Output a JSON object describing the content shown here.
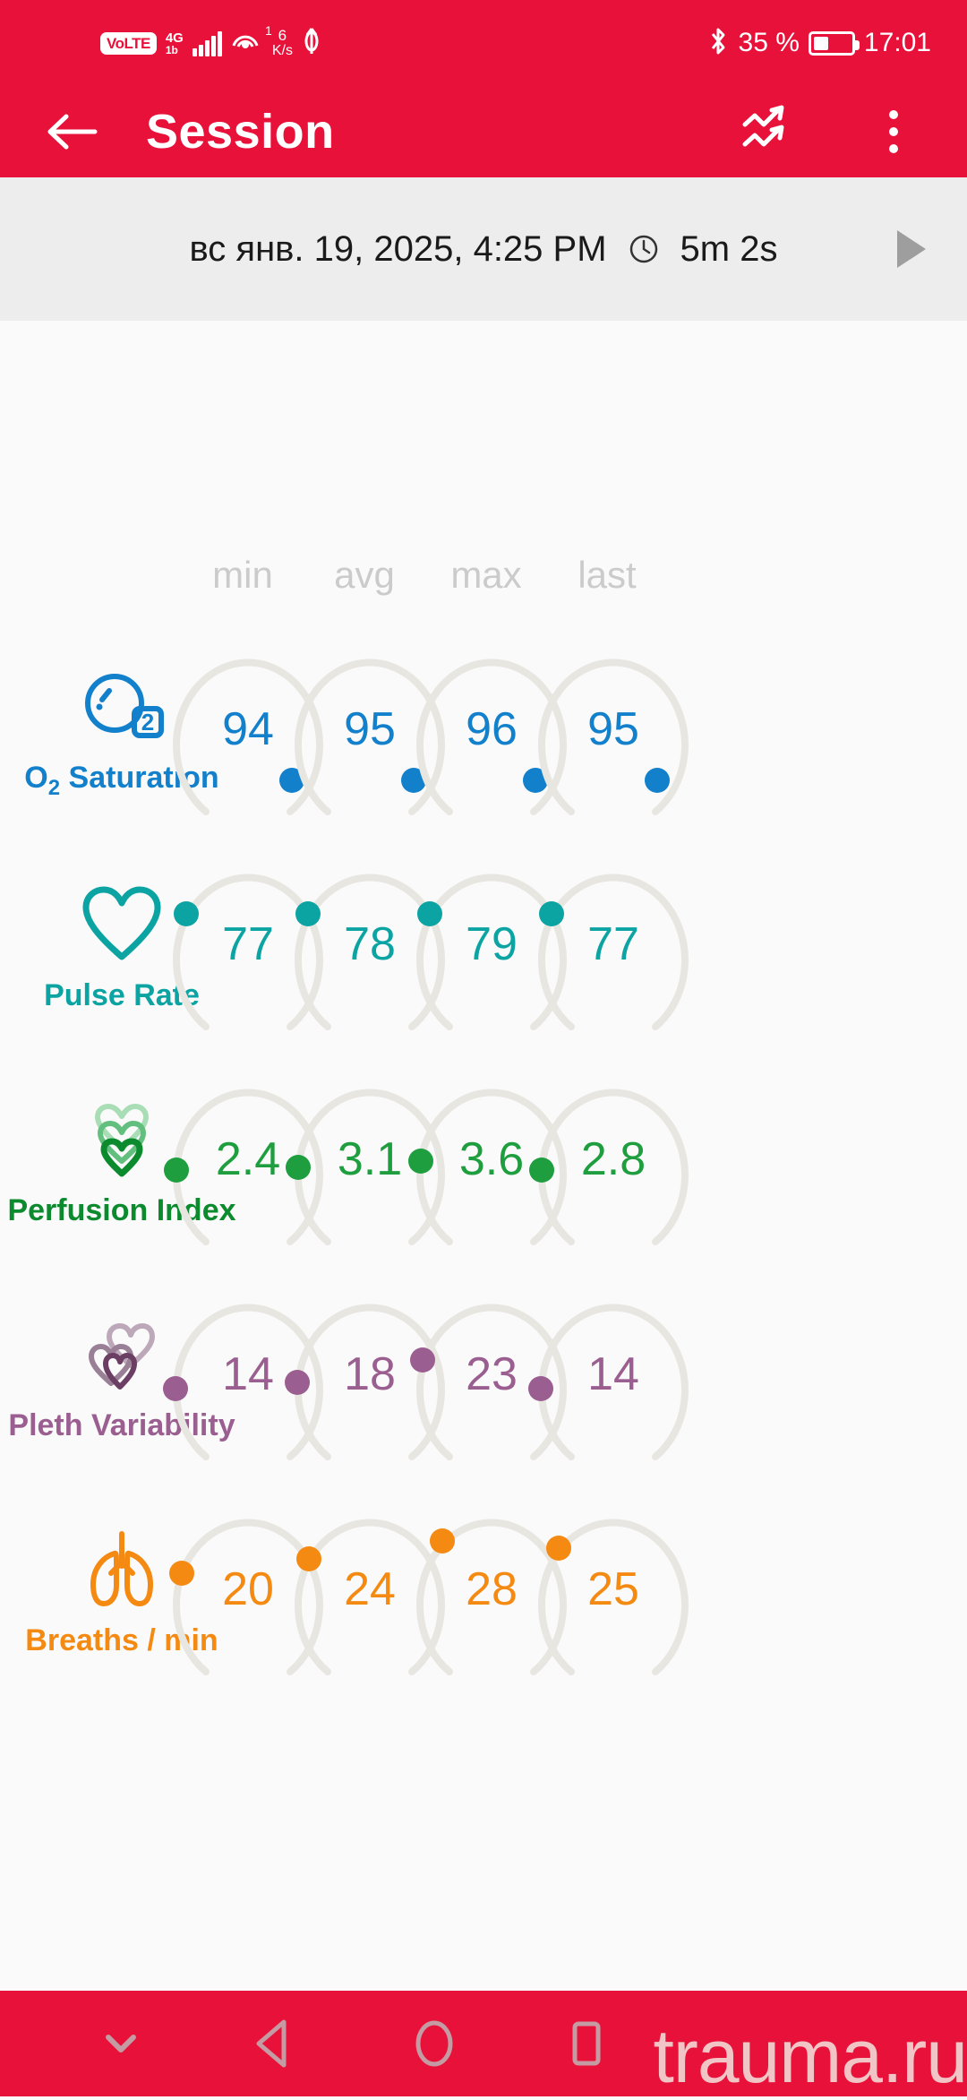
{
  "status_bar": {
    "volte_label": "VoLTE",
    "network_gen": "4G",
    "network_sub": "1b",
    "hotspot_badge": "1",
    "data_rate_value": "6",
    "data_rate_unit": "K/s",
    "battery_percent": "35 %",
    "clock": "17:01",
    "icons": [
      "volte-icon",
      "signal-bars-icon",
      "hotspot-icon",
      "data-transfer-icon",
      "usb-icon",
      "bluetooth-icon",
      "battery-icon"
    ]
  },
  "app_bar": {
    "title": "Session",
    "back_icon": "arrow-left-icon",
    "trend_icon": "trending-up-icon",
    "overflow_icon": "more-vertical-icon",
    "background": "#E8113A"
  },
  "date_bar": {
    "date_text": "вс янв. 19, 2025, 4:25 PM",
    "clock_icon": "clock-icon",
    "duration": "5m 2s",
    "play_icon": "play-icon",
    "background": "#EDEDED"
  },
  "columns": [
    "min",
    "avg",
    "max",
    "last"
  ],
  "metrics": [
    {
      "name": "O",
      "name_sub": "2",
      "name_rest": " Saturation",
      "icon": "oxygen-molecule-icon",
      "color": "#1380CC",
      "values": [
        "94",
        "95",
        "96",
        "95"
      ],
      "dot_angles": [
        55,
        55,
        55,
        55
      ]
    },
    {
      "name": "Pulse Rate",
      "name_sub": "",
      "name_rest": "",
      "icon": "heart-outline-icon",
      "color": "#0CA3A3",
      "values": [
        "77",
        "78",
        "79",
        "77"
      ],
      "dot_angles": [
        -48,
        -48,
        -48,
        -48
      ]
    },
    {
      "name": "Perfusion Index",
      "name_sub": "",
      "name_rest": "",
      "icon": "triple-heart-icon",
      "color": "#1E9E3E",
      "values": [
        "2.4",
        "3.1",
        "3.6",
        "2.8"
      ],
      "dot_angles": [
        -88,
        -88,
        -83,
        -88
      ]
    },
    {
      "name": "Pleth Variability",
      "name_sub": "",
      "name_rest": "",
      "icon": "pleth-hearts-icon",
      "color": "#9A5E90",
      "values": [
        "14",
        "18",
        "23",
        "14"
      ],
      "dot_angles": [
        -93,
        -90,
        -70,
        -93
      ]
    },
    {
      "name": "Breaths / min",
      "name_sub": "",
      "name_rest": "",
      "icon": "lungs-icon",
      "color": "#F58A12",
      "values": [
        "20",
        "24",
        "28",
        "25"
      ],
      "dot_angles": [
        -58,
        -50,
        -40,
        -45
      ]
    }
  ],
  "nav_bar": {
    "hide_icon": "chevron-down-icon",
    "back_icon": "triangle-back-icon",
    "home_icon": "circle-home-icon",
    "recents_icon": "square-recents-icon",
    "watermark": "trauma.ru",
    "background": "#E8113A"
  }
}
